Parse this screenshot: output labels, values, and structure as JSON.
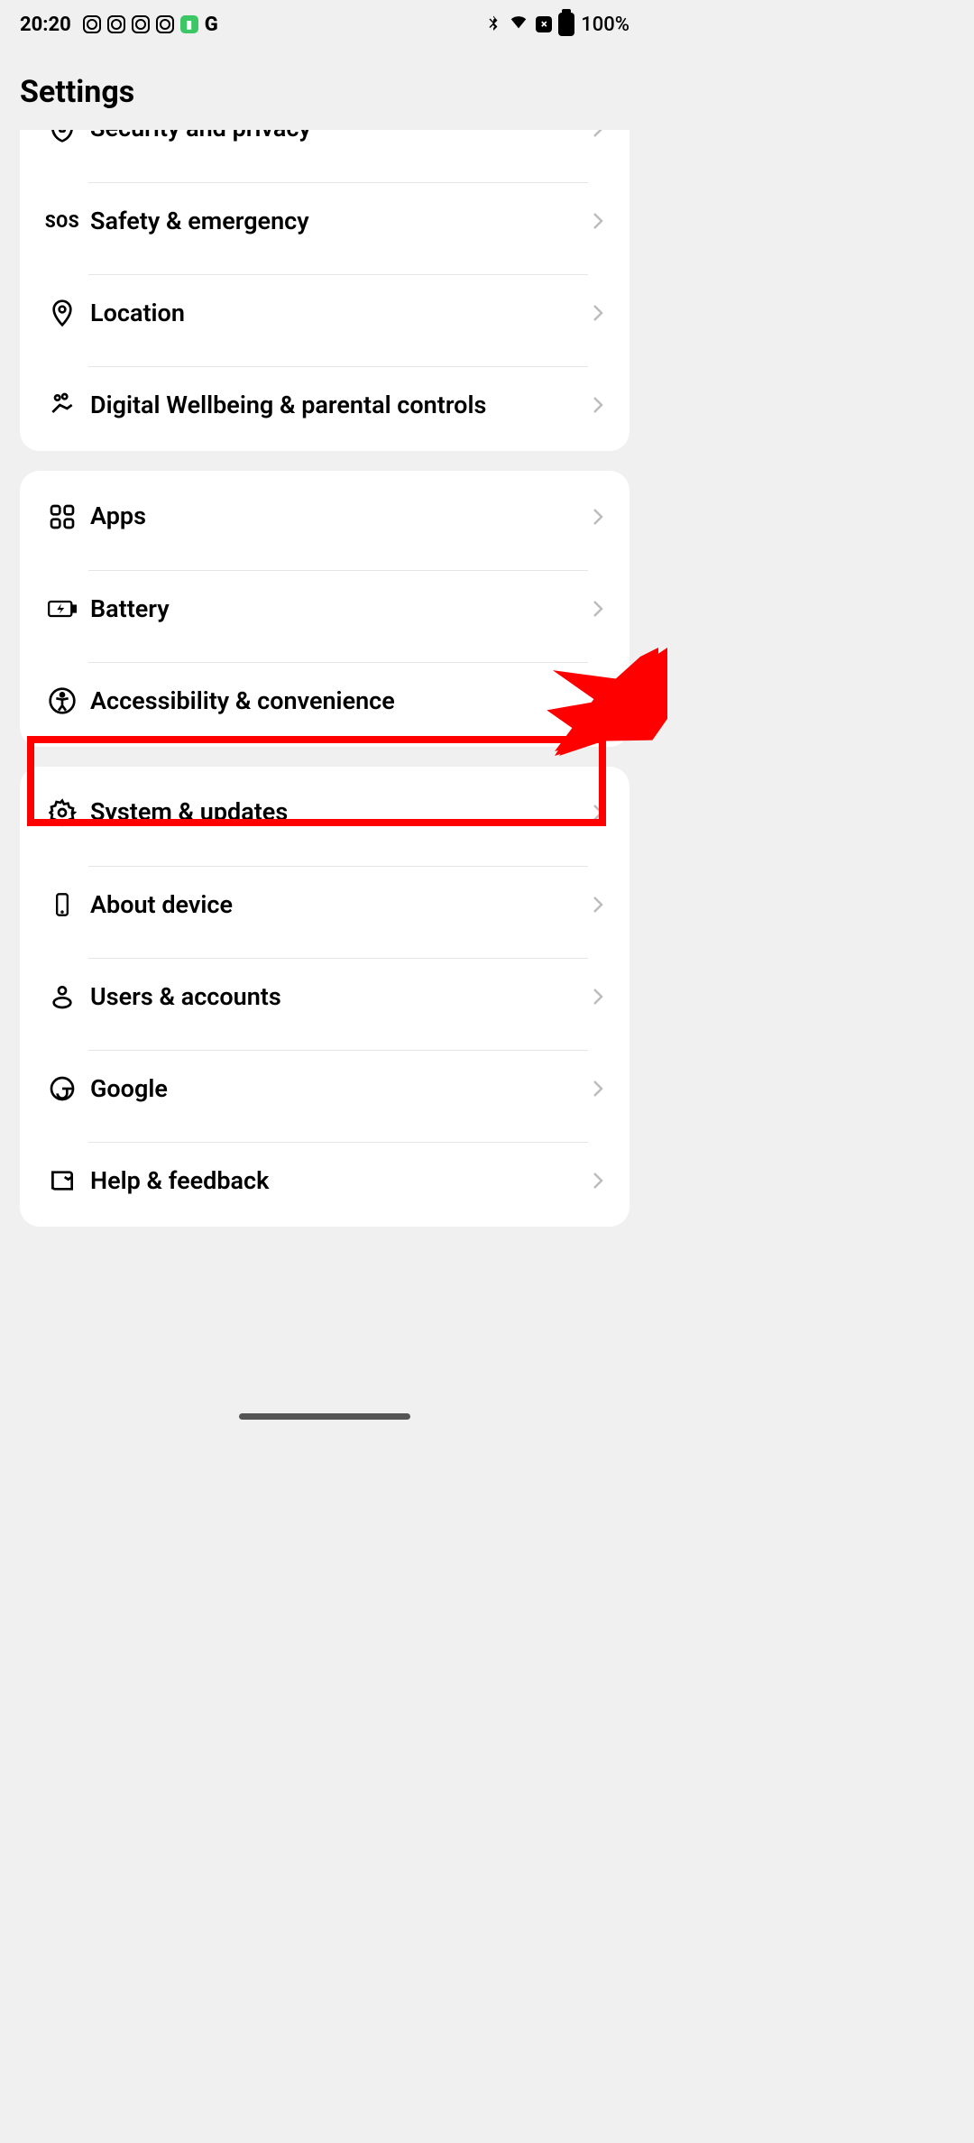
{
  "status": {
    "time": "20:20",
    "battery_pct": "100%"
  },
  "header": {
    "title": "Settings"
  },
  "groups": [
    {
      "id": "g1",
      "items": [
        {
          "id": "security",
          "label": "Security and privacy",
          "icon": "shield-icon"
        },
        {
          "id": "safety",
          "label": "Safety & emergency",
          "icon": "sos-icon"
        },
        {
          "id": "location",
          "label": "Location",
          "icon": "location-pin-icon"
        },
        {
          "id": "wellbeing",
          "label": "Digital Wellbeing & parental controls",
          "icon": "heart-hand-icon"
        }
      ]
    },
    {
      "id": "g2",
      "items": [
        {
          "id": "apps",
          "label": "Apps",
          "icon": "apps-grid-icon"
        },
        {
          "id": "battery",
          "label": "Battery",
          "icon": "battery-charge-icon"
        },
        {
          "id": "access",
          "label": "Accessibility & convenience",
          "icon": "accessibility-icon",
          "highlighted": true
        }
      ]
    },
    {
      "id": "g3",
      "items": [
        {
          "id": "system",
          "label": "System & updates",
          "icon": "gear-icon"
        },
        {
          "id": "about",
          "label": "About device",
          "icon": "phone-icon"
        },
        {
          "id": "users",
          "label": "Users & accounts",
          "icon": "user-icon"
        },
        {
          "id": "google",
          "label": "Google",
          "icon": "google-g-icon"
        },
        {
          "id": "help",
          "label": "Help & feedback",
          "icon": "book-icon"
        }
      ]
    }
  ],
  "annotation": {
    "highlight_target": "access",
    "color": "#ff0000"
  }
}
